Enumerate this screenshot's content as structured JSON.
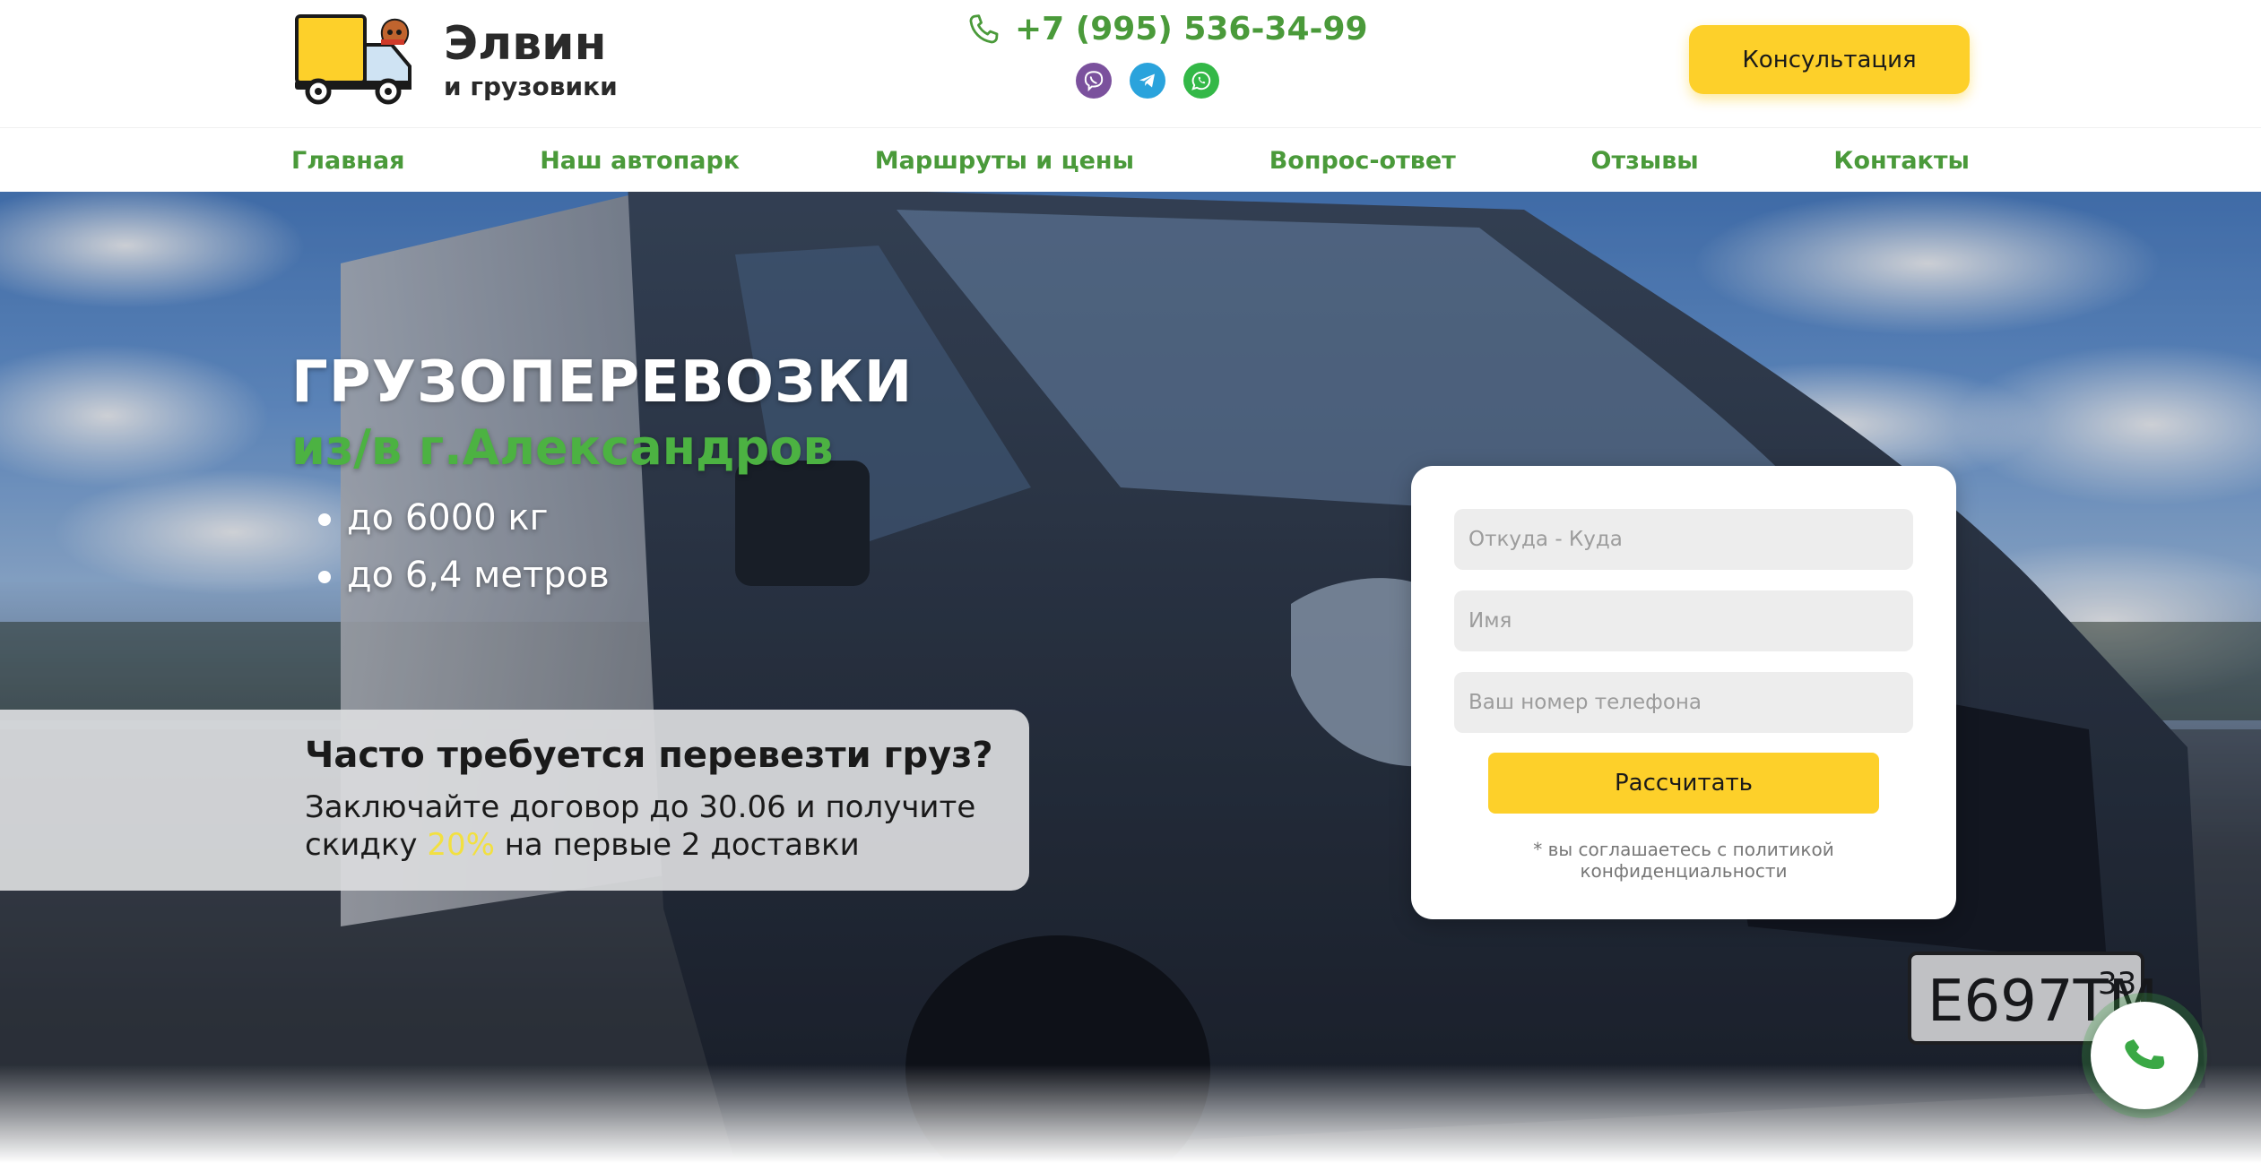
{
  "header": {
    "logo_title": "Элвин",
    "logo_subtitle": "и грузовики",
    "logo_icon": "truck-with-squirrel-icon",
    "phone": "+7 (995) 536-34-99",
    "phone_icon": "phone-icon",
    "messengers": [
      "viber-icon",
      "telegram-icon",
      "whatsapp-icon"
    ],
    "consult_label": "Консультация"
  },
  "nav": {
    "items": [
      {
        "label": "Главная"
      },
      {
        "label": "Наш автопарк"
      },
      {
        "label": "Маршруты и цены"
      },
      {
        "label": "Вопрос-ответ"
      },
      {
        "label": "Отзывы"
      },
      {
        "label": "Контакты"
      }
    ]
  },
  "hero": {
    "title": "ГРУЗОПЕРЕВОЗКИ",
    "subtitle": "из/в г.Александров",
    "features": [
      "до 6000 кг",
      "до 6,4 метров"
    ],
    "promo_title": "Часто требуется перевезти груз?",
    "promo_line1": "Заключайте договор до 30.06 и получите",
    "promo_line2_pre": "скидку ",
    "promo_accent": "20%",
    "promo_line2_post": " на первые 2 доставки"
  },
  "form": {
    "from_to_placeholder": "Откуда - Куда",
    "name_placeholder": "Имя",
    "phone_placeholder": "Ваш номер телефона",
    "submit_label": "Рассчитать",
    "policy_text_pre": "* вы соглашаетесь с ",
    "policy_link": "политикой конфиденциальности"
  },
  "call_button_icon": "phone-call-icon",
  "colors": {
    "brand_green": "#4a9a3a",
    "accent_yellow": "#fdd02a",
    "promo_accent": "#f2e040"
  }
}
